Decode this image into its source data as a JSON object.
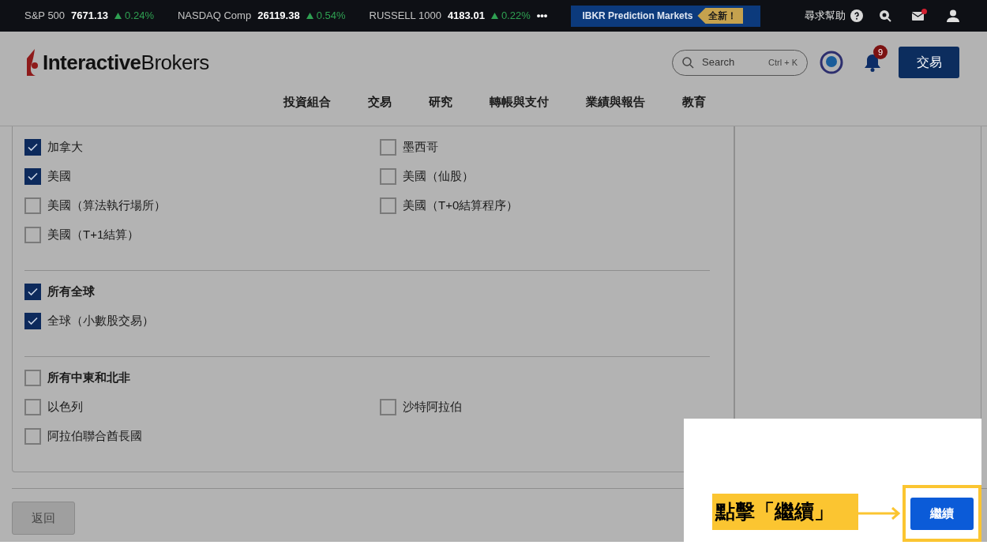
{
  "ticker": [
    {
      "name": "S&P 500",
      "value": "7671.13",
      "change": "0.24%",
      "up": true
    },
    {
      "name": "NASDAQ Comp",
      "value": "26119.38",
      "change": "0.54%",
      "up": true
    },
    {
      "name": "RUSSELL 1000",
      "value": "4183.01",
      "change": "0.22%",
      "up": true
    }
  ],
  "ticker_more": "•••",
  "promo": {
    "label": "IBKR Prediction Markets",
    "badge": "全新！"
  },
  "help": "尋求幫助",
  "mail_unread": true,
  "logo": "**Interactive**Brokers",
  "search": {
    "placeholder": "Search",
    "shortcut": "Ctrl + K"
  },
  "notifications": "9",
  "trade_button": "交易",
  "nav": [
    "投資組合",
    "交易",
    "研究",
    "轉帳與支付",
    "業績與報告",
    "教育"
  ],
  "sections": [
    {
      "items": [
        {
          "label": "加拿大",
          "checked": true
        },
        {
          "label": "墨西哥",
          "checked": false
        },
        {
          "label": "美國",
          "checked": true
        },
        {
          "label": "美國（仙股）",
          "checked": false
        },
        {
          "label": "美國（算法執行場所）",
          "checked": false
        },
        {
          "label": "美國（T+0結算程序）",
          "checked": false
        },
        {
          "label": "美國（T+1結算）",
          "checked": false
        }
      ]
    },
    {
      "header": {
        "label": "所有全球",
        "checked": true
      },
      "items": [
        {
          "label": "全球（小數股交易）",
          "checked": true
        }
      ]
    },
    {
      "header": {
        "label": "所有中東和北非",
        "checked": false
      },
      "items": [
        {
          "label": "以色列",
          "checked": false
        },
        {
          "label": "沙特阿拉伯",
          "checked": false
        },
        {
          "label": "阿拉伯聯合酋長國",
          "checked": false
        }
      ]
    }
  ],
  "back_button": "返回",
  "continue_button": "繼續",
  "annotation": "點擊「繼續」"
}
